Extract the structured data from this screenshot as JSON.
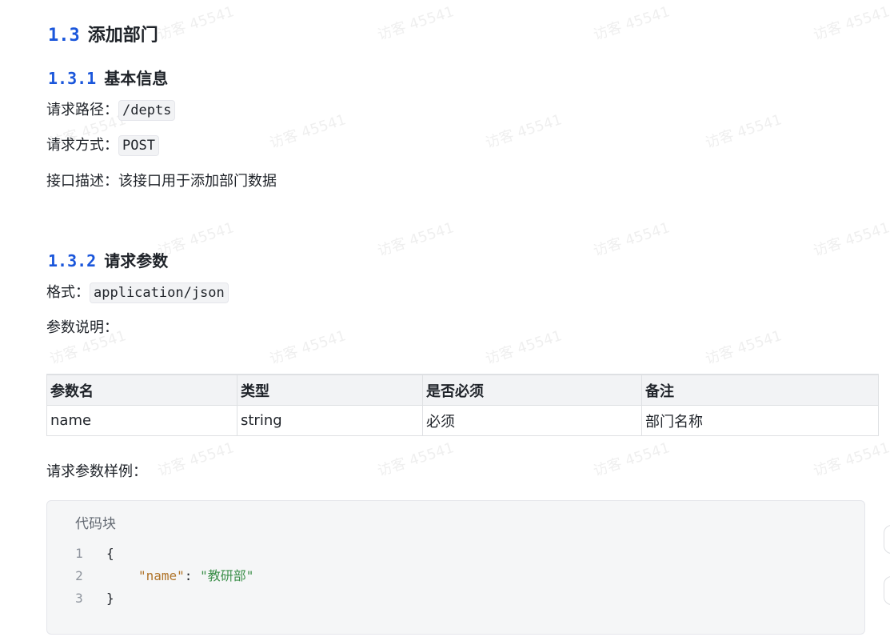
{
  "watermark": "访客 45541",
  "section": {
    "number": "1.3",
    "title": "添加部门"
  },
  "basic_info": {
    "number": "1.3.1",
    "title": "基本信息",
    "path_label": "请求路径：",
    "path_value": "/depts",
    "method_label": "请求方式：",
    "method_value": "POST",
    "desc_label": "接口描述：",
    "desc_value": "该接口用于添加部门数据"
  },
  "request_params": {
    "number": "1.3.2",
    "title": "请求参数",
    "format_label": "格式：",
    "format_value": "application/json",
    "params_desc_label": "参数说明：",
    "table": {
      "headers": [
        "参数名",
        "类型",
        "是否必须",
        "备注"
      ],
      "rows": [
        [
          "name",
          "string",
          "必须",
          "部门名称"
        ]
      ]
    },
    "example_label": "请求参数样例："
  },
  "code_block": {
    "title": "代码块",
    "lines": [
      {
        "num": "1",
        "text": "{"
      },
      {
        "num": "2",
        "key": "\"name\"",
        "sep": ": ",
        "value": "\"教研部\""
      },
      {
        "num": "3",
        "text": "}"
      }
    ]
  }
}
